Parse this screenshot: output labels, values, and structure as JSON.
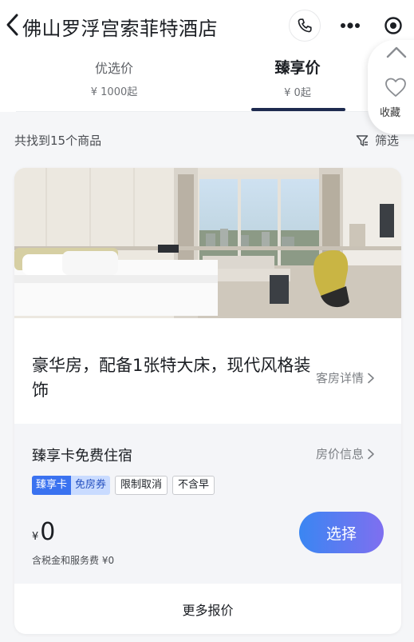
{
  "header": {
    "title": "佛山罗浮宫索菲特酒店",
    "back_icon": "chevron-left-icon",
    "phone_icon": "phone-icon",
    "more_icon": "more-dots-icon",
    "target_icon": "target-icon"
  },
  "tabs": [
    {
      "label": "优选价",
      "price": "¥ 1000起",
      "active": false
    },
    {
      "label": "臻享价",
      "price": "¥ 0起",
      "active": true
    }
  ],
  "side_panel": {
    "up_icon": "chevron-up-icon",
    "heart_icon": "heart-icon",
    "favorite_label": "收藏"
  },
  "results": {
    "count_text": "共找到15个商品",
    "filter_label": "筛选",
    "filter_icon": "filter-icon"
  },
  "room": {
    "name": "豪华房，配备1张特大床，现代风格装饰",
    "detail_link": "客房详情",
    "rate": {
      "title": "臻享卡免费住宿",
      "info_link": "房价信息",
      "tag_combo": {
        "left": "臻享卡",
        "right": "免房券"
      },
      "tags": [
        "限制取消",
        "不含早"
      ],
      "currency": "¥",
      "price": "0",
      "tax_note": "含税金和服务费 ¥0",
      "select_label": "选择"
    },
    "more_quotes": "更多报价"
  },
  "colors": {
    "accent_underline": "#1d2a4f",
    "select_gradient_start": "#3a86f2",
    "select_gradient_end": "#7f6ff0",
    "tag_blue": "#3a72f0"
  }
}
